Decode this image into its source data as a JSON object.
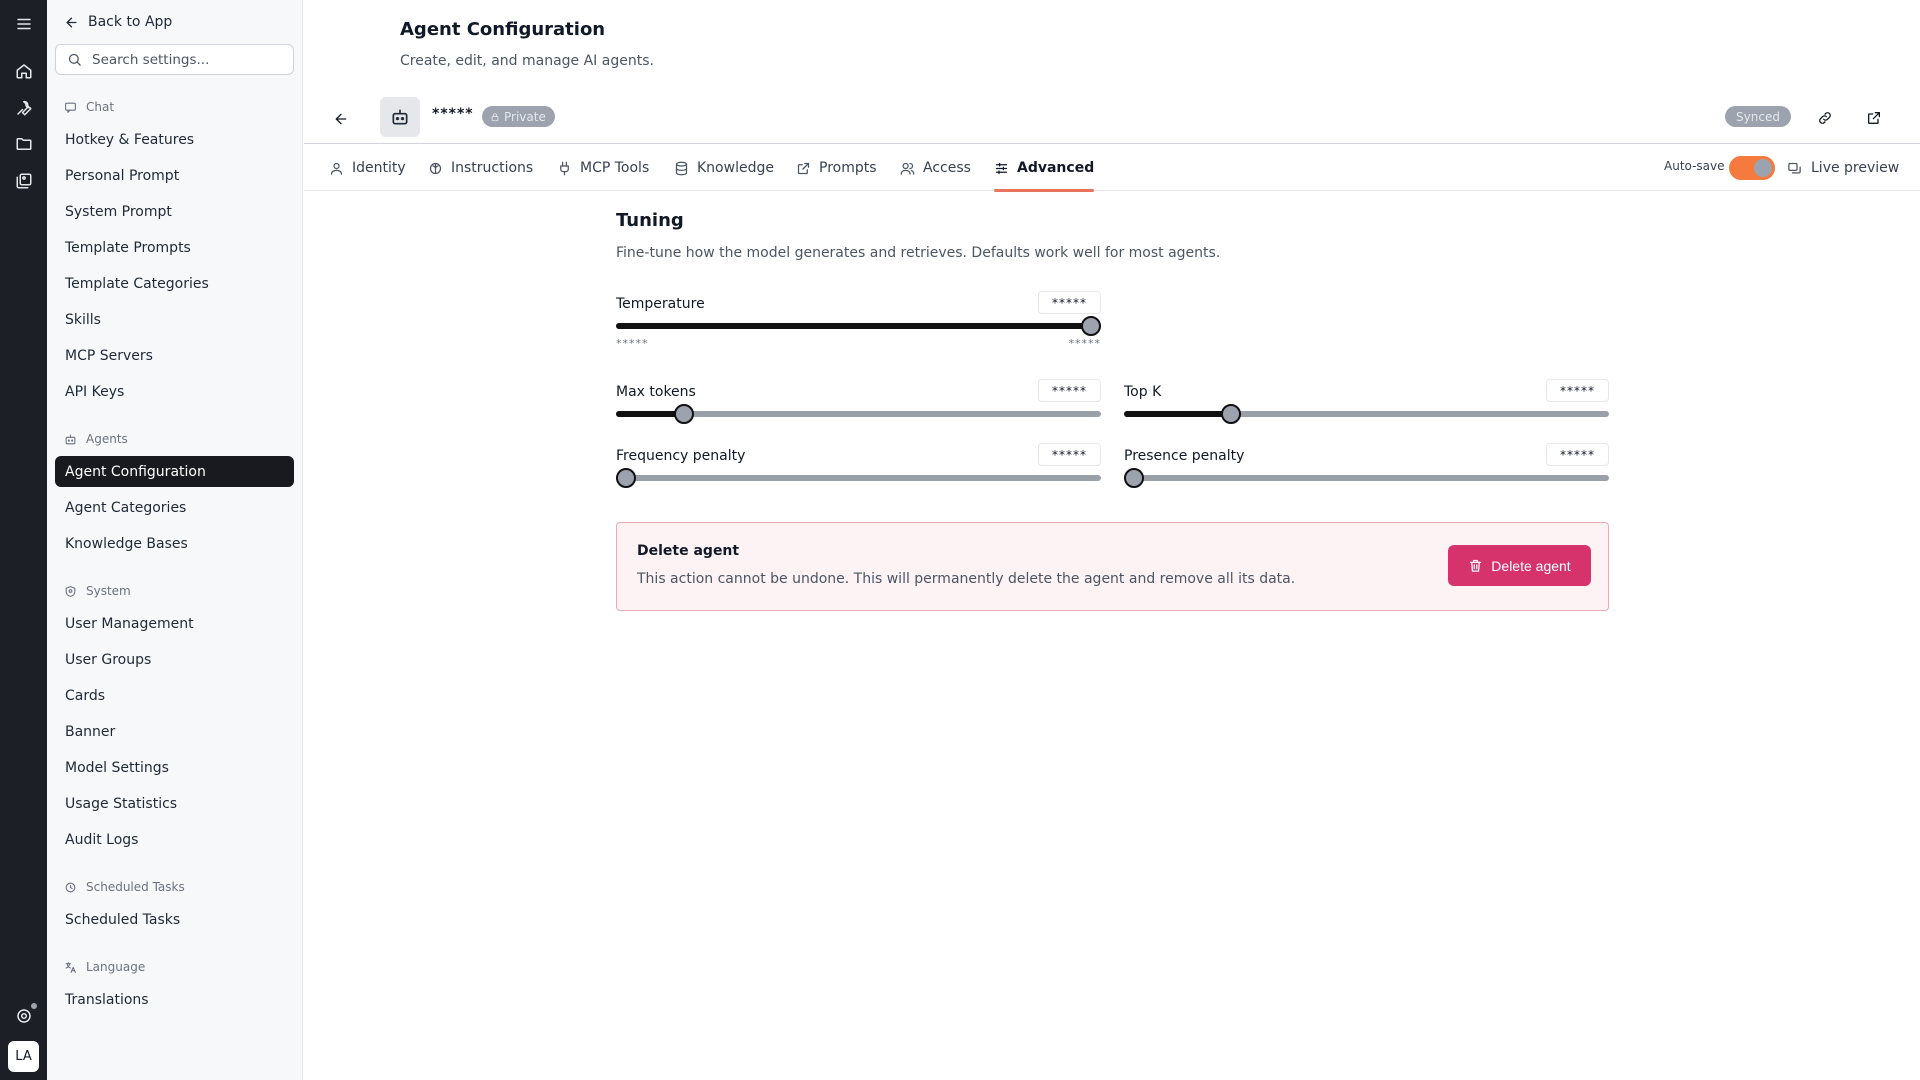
{
  "rail": {
    "icons": [
      "menu-icon",
      "home-icon",
      "wrench-icon",
      "folder-icon",
      "gallery-icon",
      "support-icon"
    ],
    "avatar": "LA"
  },
  "sidebar": {
    "back_label": "Back to App",
    "search_placeholder": "Search settings...",
    "sections": [
      {
        "label": "Chat",
        "icon": "chat-icon",
        "items": [
          "Hotkey & Features",
          "Personal Prompt",
          "System Prompt",
          "Template Prompts",
          "Template Categories",
          "Skills",
          "MCP Servers",
          "API Keys"
        ]
      },
      {
        "label": "Agents",
        "icon": "bot-icon",
        "items": [
          "Agent Configuration",
          "Agent Categories",
          "Knowledge Bases"
        ]
      },
      {
        "label": "System",
        "icon": "shield-icon",
        "items": [
          "User Management",
          "User Groups",
          "Cards",
          "Banner",
          "Model Settings",
          "Usage Statistics",
          "Audit Logs"
        ]
      },
      {
        "label": "Scheduled Tasks",
        "icon": "clock-icon",
        "items": [
          "Scheduled Tasks"
        ]
      },
      {
        "label": "Language",
        "icon": "translate-icon",
        "items": [
          "Translations"
        ]
      }
    ],
    "active_item": "Agent Configuration"
  },
  "header": {
    "title": "Agent Configuration",
    "subtitle": "Create, edit, and manage AI agents."
  },
  "agent_bar": {
    "name": "*****",
    "visibility": "Private",
    "sync_status": "Synced"
  },
  "tabs": [
    {
      "label": "Identity",
      "icon": "user-icon"
    },
    {
      "label": "Instructions",
      "icon": "brain-icon"
    },
    {
      "label": "MCP Tools",
      "icon": "plug-icon"
    },
    {
      "label": "Knowledge",
      "icon": "database-icon"
    },
    {
      "label": "Prompts",
      "icon": "external-icon"
    },
    {
      "label": "Access",
      "icon": "users-icon"
    },
    {
      "label": "Advanced",
      "icon": "sliders-icon",
      "active": true
    }
  ],
  "toolbar": {
    "autosave_label": "Auto-save",
    "autosave_on": true,
    "live_preview_label": "Live preview"
  },
  "tuning": {
    "title": "Tuning",
    "description": "Fine-tune how the model generates and retrieves. Defaults work well for most agents.",
    "temperature": {
      "label": "Temperature",
      "value": "*****",
      "min_label": "*****",
      "max_label": "*****",
      "level": 0.98
    },
    "max_tokens": {
      "label": "Max tokens",
      "value": "*****",
      "level": 0.14
    },
    "top_k": {
      "label": "Top K",
      "value": "*****",
      "level": 0.22
    },
    "frequency_penalty": {
      "label": "Frequency penalty",
      "value": "*****",
      "level": 0.02
    },
    "presence_penalty": {
      "label": "Presence penalty",
      "value": "*****",
      "level": 0.02
    }
  },
  "danger": {
    "title": "Delete agent",
    "description": "This action cannot be undone. This will permanently delete the agent and remove all its data.",
    "button_label": "Delete agent"
  },
  "colors": {
    "rail_bg": "#1c1f26",
    "active_nav": "#181a1f",
    "tab_underline": "#e8735a",
    "toggle_on": "#f47a3e",
    "danger_button": "#d6336c"
  }
}
